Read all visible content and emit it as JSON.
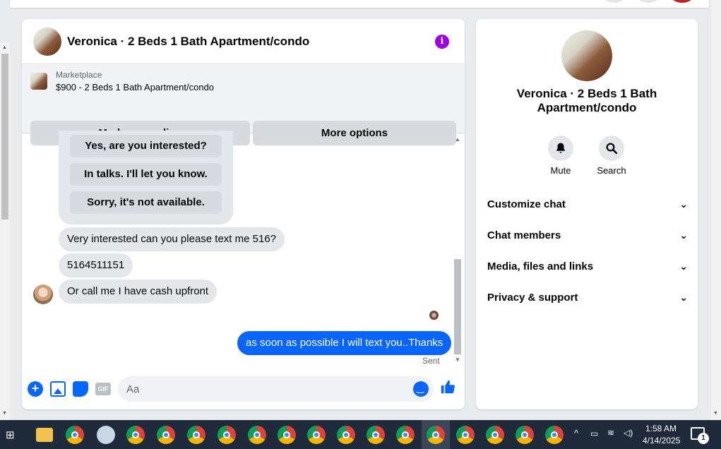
{
  "chat": {
    "title": "Veronica · 2 Beds 1 Bath Apartment/condo",
    "marketplace_label": "Marketplace",
    "listing": "$900 - 2 Beds 1 Bath Apartment/condo",
    "mark_pending_label": "Mark as pending",
    "more_options_label": "More options"
  },
  "quick_replies": [
    "Yes, are you interested?",
    "In talks. I'll let you know.",
    "Sorry, it's not available."
  ],
  "messages": [
    {
      "from": "them",
      "text": "Very interested can you please text me 516?"
    },
    {
      "from": "them",
      "text": "5164511151"
    },
    {
      "from": "them",
      "text": "Or call me I have cash upfront"
    },
    {
      "from": "me",
      "text": "as soon as possible I will text you..Thanks"
    }
  ],
  "status": "Sent",
  "composer": {
    "placeholder": "Aa",
    "gif_label": "GIF"
  },
  "side": {
    "name": "Veronica · 2 Beds 1 Bath Apartment/condo",
    "actions": [
      {
        "label": "Mute",
        "icon": "bell-icon"
      },
      {
        "label": "Search",
        "icon": "search-icon"
      }
    ],
    "sections": [
      "Customize chat",
      "Chat members",
      "Media, files and links",
      "Privacy & support"
    ]
  },
  "taskbar": {
    "time": "1:58 AM",
    "date": "4/14/2025",
    "notifications": "1"
  },
  "colors": {
    "accent": "#0866ff",
    "info": "#9b00e6",
    "taskbar": "#1f2a3a"
  }
}
